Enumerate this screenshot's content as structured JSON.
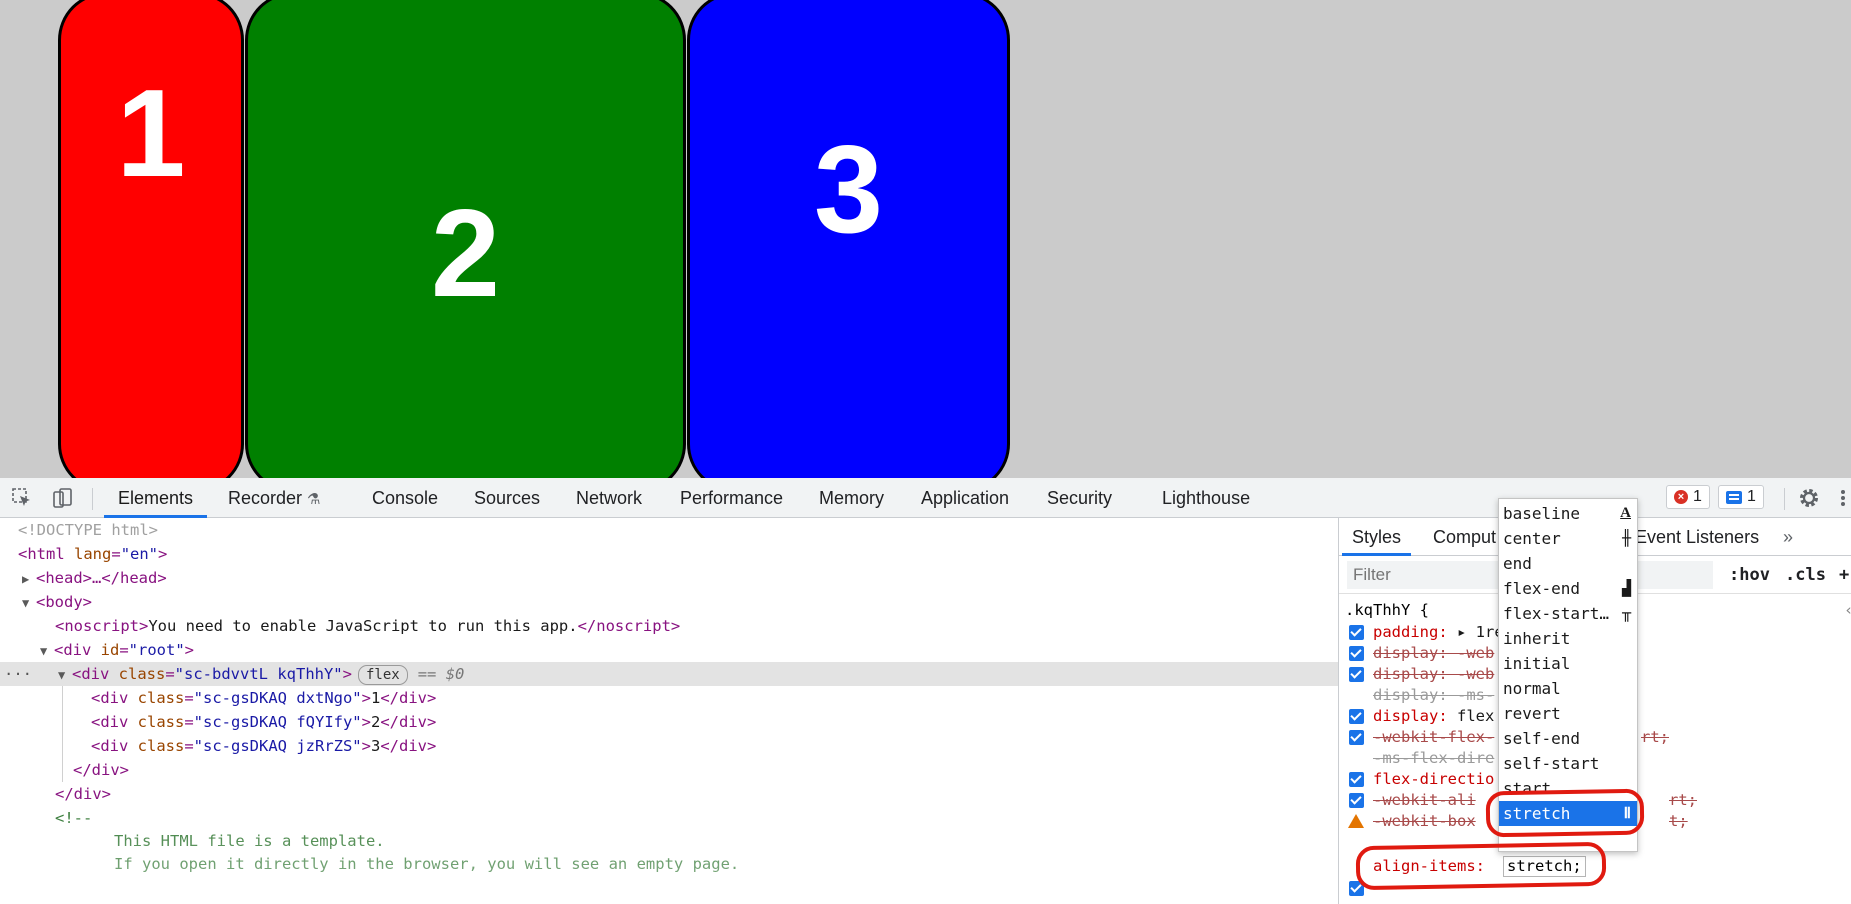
{
  "page": {
    "boxes": [
      {
        "label": "1",
        "color": "#ff0000"
      },
      {
        "label": "2",
        "color": "#008000"
      },
      {
        "label": "3",
        "color": "#0000ff"
      }
    ]
  },
  "devtools": {
    "tabs": [
      "Elements",
      "Recorder",
      "Console",
      "Sources",
      "Network",
      "Performance",
      "Memory",
      "Application",
      "Security",
      "Lighthouse"
    ],
    "active_tab": "Elements",
    "error_count": "1",
    "message_count": "1",
    "elements": {
      "doctype": "<!DOCTYPE html>",
      "html_open": "<html",
      "html_attr": " lang",
      "html_val": "\"en\"",
      "head": "<head>…</head>",
      "body_open": "<body>",
      "noscript_open": "<noscript>",
      "noscript_text": "You need to enable JavaScript to run this app.",
      "noscript_close": "</noscript>",
      "root_open": "<div",
      "root_attr": " id",
      "root_val": "\"root\"",
      "selected_open": "<div",
      "selected_attr": " class",
      "selected_val": "\"sc-bdvvtL kqThhY\"",
      "flex_pill": "flex",
      "eq0": "== $0",
      "children": [
        {
          "cls": "\"sc-gsDKAQ dxtNgo\"",
          "text": "1"
        },
        {
          "cls": "\"sc-gsDKAQ fQYIfy\"",
          "text": "2"
        },
        {
          "cls": "\"sc-gsDKAQ jzRrZS\"",
          "text": "3"
        }
      ],
      "div_close": "</div>",
      "comment_open": "<!--",
      "comment_line1": "This HTML file is a template.",
      "comment_line2": "If you open it directly in the browser, you will see an empty page."
    },
    "styles": {
      "tabs": [
        "Styles",
        "Comput",
        "Event Listeners"
      ],
      "filter_placeholder": "Filter",
      "hov": ":hov",
      "cls": ".cls",
      "selector": ".kqThhY {",
      "declarations": [
        {
          "text": "padding:",
          "value": " ▸ 1re",
          "state": "on"
        },
        {
          "text": "display: -web",
          "value": "",
          "state": "off"
        },
        {
          "text": "display: -web",
          "value": "",
          "state": "off"
        },
        {
          "text": "display: -ms-",
          "value": "",
          "state": "gray"
        },
        {
          "text": "display:",
          "value": " flex",
          "state": "on"
        },
        {
          "text": "-webkit-flex-",
          "value": "",
          "state": "off"
        },
        {
          "text": "-ms-flex-dire",
          "value": "",
          "state": "gray"
        },
        {
          "text": "flex-directio",
          "value": "",
          "state": "on"
        },
        {
          "text": "-webkit-ali",
          "value": "",
          "state": "off"
        },
        {
          "text": "-webkit-box",
          "value": "",
          "state": "warn"
        }
      ],
      "tail_1": "rt;",
      "tail_2": "rt;",
      "tail_3": "t;",
      "align_items_prop": "align-items:",
      "align_items_value": "stretch;"
    },
    "dropdown": {
      "options": [
        "baseline",
        "center",
        "end",
        "flex-end",
        "flex-start…",
        "inherit",
        "initial",
        "normal",
        "revert",
        "self-end",
        "self-start",
        "start",
        "stretch"
      ],
      "selected": "stretch"
    }
  }
}
